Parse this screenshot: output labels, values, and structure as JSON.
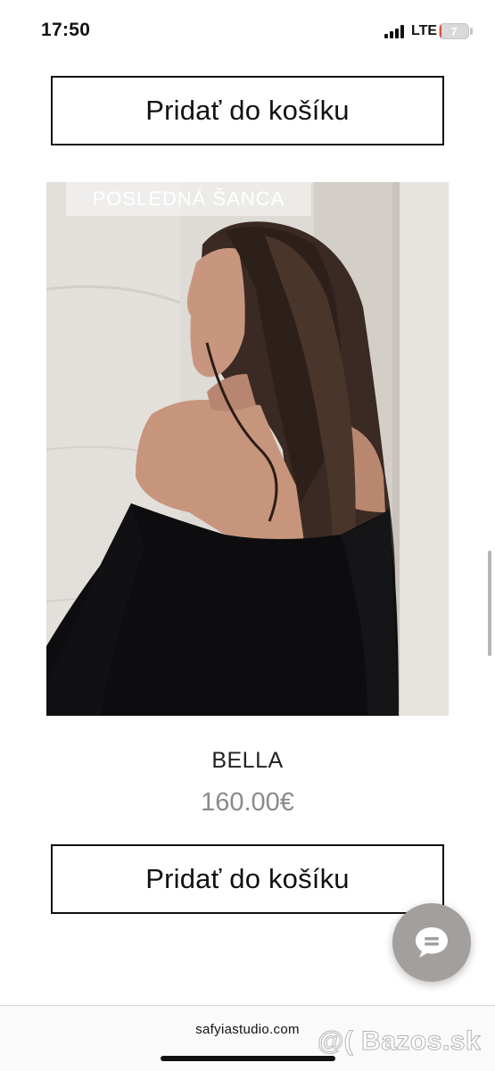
{
  "status_bar": {
    "time": "17:50",
    "network": "LTE",
    "battery_level": "7",
    "battery_color": "#e24b3b"
  },
  "cart_button_top": {
    "label": "Pridať do košíku"
  },
  "product": {
    "badge": "POSLEDNÁ ŠANCA",
    "name": "BELLA",
    "price": "160.00€",
    "image_icon": "product-photo-woman-long-dark-hair-black-offshoulder-top"
  },
  "cart_button_bottom": {
    "label": "Pridať do košíku"
  },
  "chat": {
    "icon": "chat-bubble-icon",
    "color": "#a39f9d"
  },
  "browser": {
    "url": "safyiastudio.com"
  },
  "watermark": {
    "text": "@( Bazos.sk"
  }
}
